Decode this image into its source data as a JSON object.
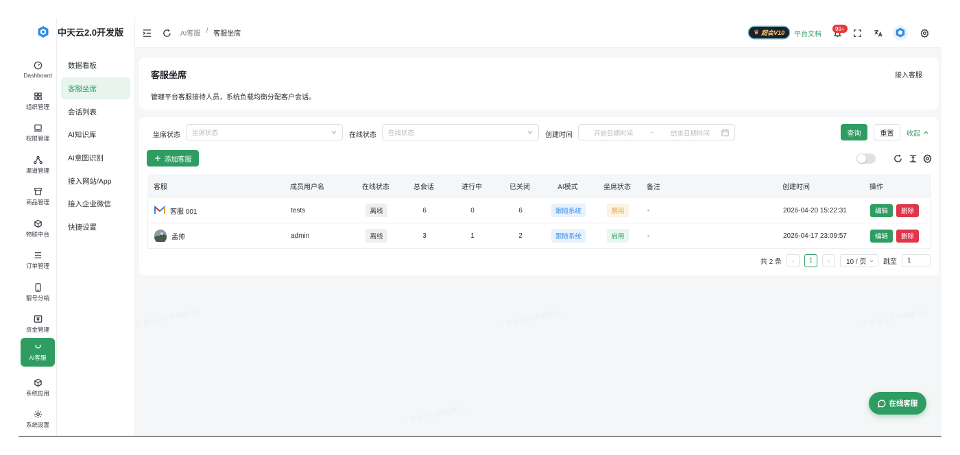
{
  "brand": {
    "name": "中天云2.0开发版"
  },
  "rail": [
    {
      "label": "Dashboard",
      "icon": "dashboard-icon"
    },
    {
      "label": "组织管理",
      "icon": "grid-icon"
    },
    {
      "label": "权限管理",
      "icon": "monitor-icon"
    },
    {
      "label": "渠道管理",
      "icon": "network-icon"
    },
    {
      "label": "商品管理",
      "icon": "store-icon"
    },
    {
      "label": "物联中台",
      "icon": "cube-icon"
    },
    {
      "label": "订单管理",
      "icon": "list-icon"
    },
    {
      "label": "靓号分销",
      "icon": "phone-icon"
    },
    {
      "label": "资金管理",
      "icon": "yuan-icon"
    },
    {
      "label": "AI客服",
      "icon": "ai-service-icon"
    },
    {
      "label": "系统应用",
      "icon": "box-icon"
    },
    {
      "label": "系统设置",
      "icon": "gear-icon"
    }
  ],
  "submenu": [
    "数据看板",
    "客服坐席",
    "会话列表",
    "AI知识库",
    "AI意图识别",
    "接入网站/App",
    "接入企业微信",
    "快捷设置"
  ],
  "header": {
    "breadcrumb": [
      "AI客服",
      "/",
      "客服坐席"
    ],
    "vip_label": "超会V10",
    "docs_label": "平台文档",
    "notification_count": "99+"
  },
  "page": {
    "title": "客服坐席",
    "description": "管理平台客服接待人员，系统负载均衡分配客户会话。",
    "connect_link": "接入客服"
  },
  "filters": {
    "seat_status_label": "坐席状态",
    "seat_status_placeholder": "坐席状态",
    "online_status_label": "在线状态",
    "online_status_placeholder": "在线状态",
    "created_label": "创建时间",
    "start_placeholder": "开始日期时间",
    "range_arrow": "→",
    "end_placeholder": "结束日期时间",
    "query_btn": "查询",
    "reset_btn": "重置",
    "collapse_btn": "收起"
  },
  "toolbar": {
    "add_btn": "添加客服"
  },
  "table": {
    "columns": [
      "客服",
      "成员用户名",
      "在线状态",
      "总会话",
      "进行中",
      "已关闭",
      "AI模式",
      "坐席状态",
      "备注",
      "创建时间",
      "操作"
    ],
    "rows": [
      {
        "name": "客服 001",
        "username": "tests",
        "online": "离线",
        "total": "6",
        "ongoing": "0",
        "closed": "6",
        "ai_mode": "跟随系统",
        "seat": "禁用",
        "seat_color": "#e6a23c",
        "note": "-",
        "created": "2026-04-20 15:22:31",
        "edit": "编辑",
        "delete": "删除"
      },
      {
        "name": "孟帅",
        "username": "admin",
        "online": "离线",
        "total": "3",
        "ongoing": "1",
        "closed": "2",
        "ai_mode": "跟随系统",
        "seat": "启用",
        "seat_color": "#2f9d62",
        "note": "-",
        "created": "2026-04-17 23:09:57",
        "edit": "编辑",
        "delete": "删除"
      }
    ]
  },
  "pagination": {
    "total": "共 2 条",
    "current": "1",
    "page_size": "10 / 页",
    "goto_label": "跳至",
    "goto_value": "1"
  },
  "float_button": "在线客服",
  "colors": {
    "primary": "#2f9d62",
    "danger": "#e0354b",
    "warning": "#e6a23c",
    "info": "#3a8ee6"
  }
}
